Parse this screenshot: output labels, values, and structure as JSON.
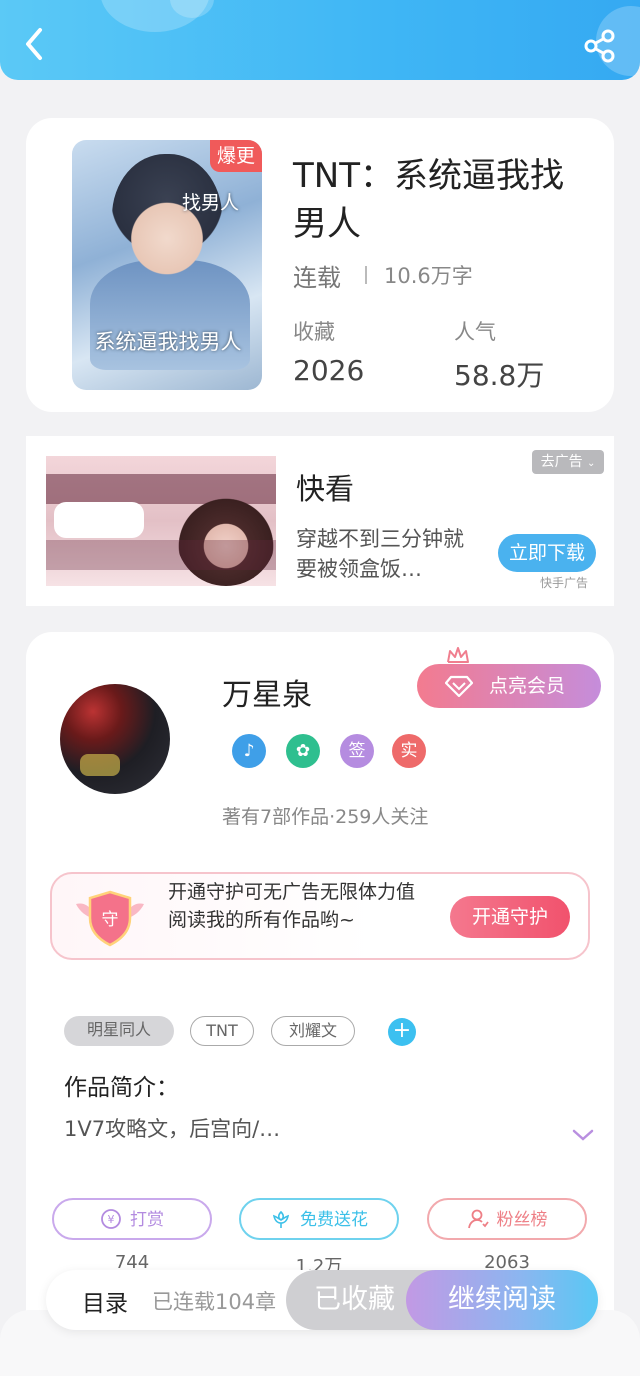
{
  "header": {
    "back_icon": "chevron-left-icon",
    "share_icon": "share-icon",
    "accent": "#3fb6f5"
  },
  "book": {
    "cover_badge": "爆更",
    "cover_title": "系统逼我找男人",
    "cover_top_text": "找男人",
    "title": "TNT：系统逼我找男人",
    "status": "连载",
    "word_count": "10.6万字",
    "collect_label": "收藏",
    "collect_value": "2026",
    "popularity_label": "人气",
    "popularity_value": "58.8万"
  },
  "ad": {
    "remove_label": "去广告",
    "name": "快看",
    "description": "穿越不到三分钟就要被领盒饭…",
    "download_label": "立即下载",
    "source": "快手广告"
  },
  "author": {
    "name": "万星泉",
    "vip_label": "点亮会员",
    "badges": [
      {
        "icon": "music-note-icon",
        "color": "#3f9fe8"
      },
      {
        "icon": "handshake-icon",
        "color": "#2fbf8f"
      },
      {
        "text": "签",
        "color": "#b58ce0"
      },
      {
        "text": "实",
        "color": "#ee6a6a"
      }
    ],
    "stats": "著有7部作品·259人关注"
  },
  "guard": {
    "text": "开通守护可无广告无限体力值阅读我的所有作品哟~",
    "shield_char": "守",
    "button_label": "开通守护"
  },
  "tags": [
    "明星同人",
    "TNT",
    "刘耀文"
  ],
  "intro": {
    "title": "作品简介：",
    "text": "1V7攻略文，后宫向/…"
  },
  "actions": [
    {
      "label": "打赏",
      "icon": "coin-icon",
      "count": "744",
      "color": "#b38be0"
    },
    {
      "label": "免费送花",
      "icon": "flower-icon",
      "count": "1.2万",
      "color": "#3cc0e8"
    },
    {
      "label": "粉丝榜",
      "icon": "fans-icon",
      "count": "2063",
      "color": "#ee7f86"
    }
  ],
  "bottom": {
    "toc_label": "目录",
    "toc_info": "已连载104章",
    "favorited_label": "已收藏",
    "read_label": "继续阅读"
  }
}
